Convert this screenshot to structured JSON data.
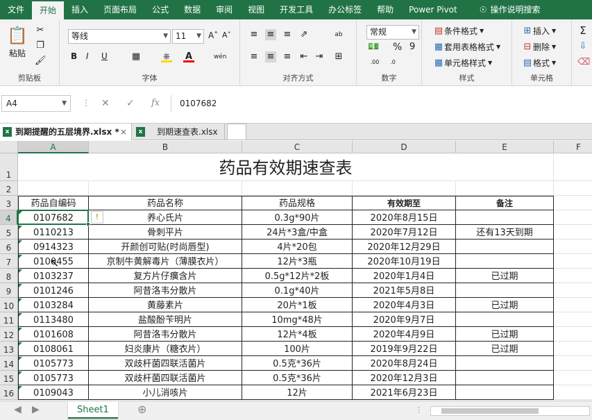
{
  "ribbon_tabs": [
    "文件",
    "开始",
    "插入",
    "页面布局",
    "公式",
    "数据",
    "审阅",
    "视图",
    "开发工具",
    "办公标签",
    "帮助",
    "Power Pivot",
    "操作说明搜索"
  ],
  "clipboard": {
    "paste": "粘贴",
    "label": "剪贴板"
  },
  "font": {
    "name": "等线",
    "size": "11",
    "label": "字体",
    "bold": "B",
    "italic": "I",
    "underline": "U",
    "grow": "A˄",
    "shrink": "A˅"
  },
  "alignment": {
    "label": "对齐方式"
  },
  "number": {
    "format": "常规",
    "label": "数字",
    "percent": "%",
    "comma": "9"
  },
  "styles": {
    "cond": "条件格式",
    "table": "套用表格格式",
    "cell": "单元格样式",
    "label": "样式"
  },
  "cells": {
    "insert": "插入",
    "delete": "删除",
    "format": "格式",
    "label": "单元格"
  },
  "formula_bar": {
    "name_box": "A4",
    "fx": "fx",
    "value": "0107682"
  },
  "file_tabs": [
    {
      "name": "到期提醒的五层境界.xlsx *",
      "close": "×"
    },
    {
      "name": "到期速查表.xlsx"
    }
  ],
  "columns": [
    "A",
    "B",
    "C",
    "D",
    "E",
    "F"
  ],
  "rows": [
    "1",
    "2",
    "3",
    "4",
    "5",
    "6",
    "7",
    "8",
    "9",
    "10",
    "11",
    "12",
    "13",
    "14",
    "15",
    "16"
  ],
  "sheet_title": "药品有效期速查表",
  "table_headers": [
    "药品自编码",
    "药品名称",
    "药品规格",
    "有效期至",
    "备注"
  ],
  "table_rows": [
    [
      "0107682",
      "养心氏片",
      "0.3g*90片",
      "2020年8月15日",
      ""
    ],
    [
      "0110213",
      "骨刺平片",
      "24片*3盒/中盒",
      "2020年7月12日",
      "还有13天到期"
    ],
    [
      "0914323",
      "开颜创可贴(时尚唇型)",
      "4片*20包",
      "2020年12月29日",
      ""
    ],
    [
      "0100455",
      "京制牛黄解毒片（薄膜衣片）",
      "12片*3瓶",
      "2020年10月19日",
      ""
    ],
    [
      "0103237",
      "复方片仔癀含片",
      "0.5g*12片*2板",
      "2020年1月4日",
      "已过期"
    ],
    [
      "0101246",
      "阿昔洛韦分散片",
      "0.1g*40片",
      "2021年5月8日",
      ""
    ],
    [
      "0103284",
      "黄藤素片",
      "20片*1板",
      "2020年4月3日",
      "已过期"
    ],
    [
      "0113480",
      "盐酸酚苄明片",
      "10mg*48片",
      "2020年9月7日",
      ""
    ],
    [
      "0101608",
      "阿昔洛韦分散片",
      "12片*4板",
      "2020年4月9日",
      "已过期"
    ],
    [
      "0108061",
      "妇炎康片（糖衣片）",
      "100片",
      "2019年9月22日",
      "已过期"
    ],
    [
      "0105773",
      "双歧杆菌四联活菌片",
      "0.5克*36片",
      "2020年8月24日",
      ""
    ],
    [
      "0105773",
      "双歧杆菌四联活菌片",
      "0.5克*36片",
      "2020年12月3日",
      ""
    ],
    [
      "0109043",
      "小儿消咳片",
      "12片",
      "2021年6月23日",
      ""
    ]
  ],
  "sheet_tabs": [
    "Sheet1"
  ],
  "colors": {
    "accent": "#217346",
    "warning": "#b06f00"
  }
}
